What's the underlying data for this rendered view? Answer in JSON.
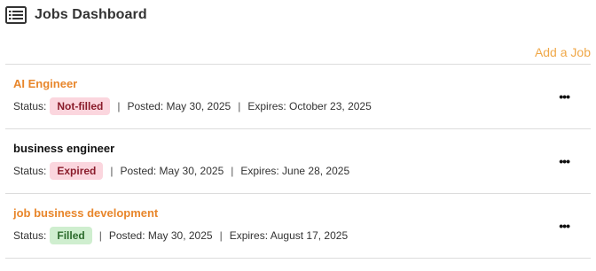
{
  "header": {
    "title": "Jobs Dashboard",
    "icon": "list-icon"
  },
  "add_job_label": "Add a Job",
  "colors": {
    "accent": "#e8862b",
    "add_link": "#f0a848",
    "badge_red_bg": "#fbd6de",
    "badge_green_bg": "#cfeecf"
  },
  "jobs": [
    {
      "title": "AI Engineer",
      "status_label": "Status:",
      "status": "Not-filled",
      "posted": "Posted: May 30, 2025",
      "expires": "Expires: October 23, 2025",
      "menu": "•••"
    },
    {
      "title": "business engineer",
      "status_label": "Status:",
      "status": "Expired",
      "posted": "Posted: May 30, 2025",
      "expires": "Expires: June 28, 2025",
      "menu": "•••"
    },
    {
      "title": "job business development",
      "status_label": "Status:",
      "status": "Filled",
      "posted": "Posted: May 30, 2025",
      "expires": "Expires: August 17, 2025",
      "menu": "•••"
    }
  ]
}
